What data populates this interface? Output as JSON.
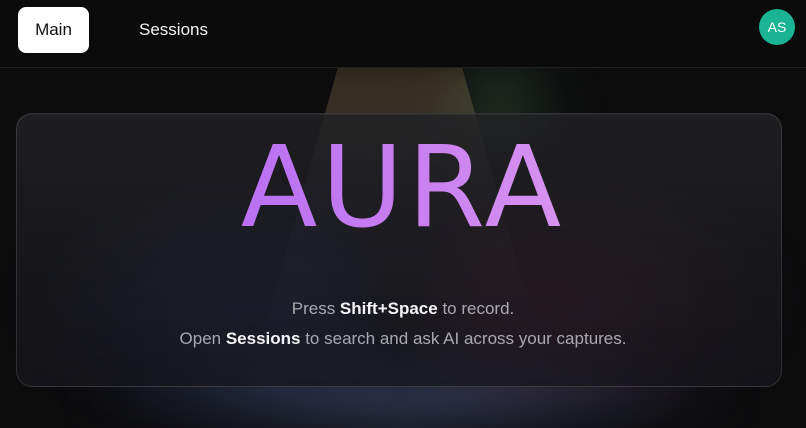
{
  "nav": {
    "tabs": [
      {
        "label": "Main",
        "active": true
      },
      {
        "label": "Sessions",
        "active": false
      }
    ],
    "avatar_initials": "AS",
    "avatar_color": "#1ab394"
  },
  "hero": {
    "title": "AURA",
    "title_gradient": [
      "#a45cf5",
      "#f0b2ee"
    ],
    "line1": {
      "prefix": "Press ",
      "emphasis": "Shift+Space",
      "suffix": " to record."
    },
    "line2": {
      "prefix": "Open ",
      "emphasis": "Sessions",
      "suffix": " to search and ask AI across your captures."
    }
  }
}
